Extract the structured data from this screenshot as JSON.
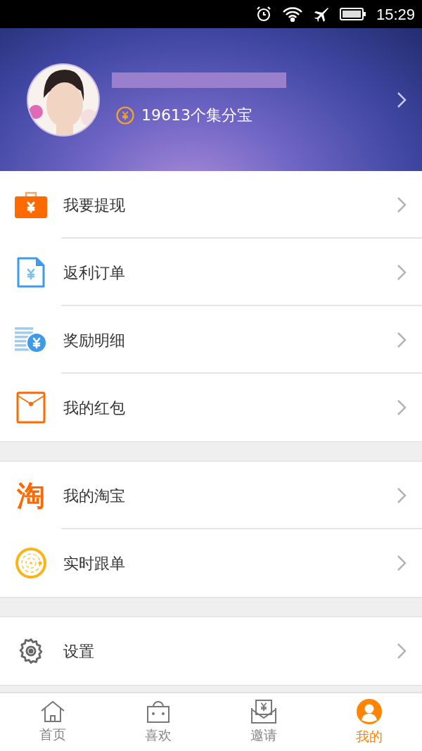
{
  "status_bar": {
    "time": "15:29"
  },
  "profile": {
    "points": "19613个集分宝"
  },
  "menu_groups": [
    [
      {
        "kind": "wallet",
        "label": "我要提现"
      },
      {
        "kind": "document",
        "label": "返利订单"
      },
      {
        "kind": "coins",
        "label": "奖励明细"
      },
      {
        "kind": "envelope",
        "label": "我的红包"
      }
    ],
    [
      {
        "kind": "glyph",
        "glyph": "淘",
        "label": "我的淘宝"
      },
      {
        "kind": "radar",
        "label": "实时跟单"
      }
    ],
    [
      {
        "kind": "gear",
        "label": "设置"
      }
    ]
  ],
  "tab_bar": [
    {
      "kind": "home",
      "label": "首页",
      "selected": false
    },
    {
      "kind": "bag",
      "label": "喜欢",
      "selected": false
    },
    {
      "kind": "invite",
      "label": "邀请",
      "selected": false
    },
    {
      "kind": "person",
      "label": "我的",
      "selected": true
    }
  ]
}
